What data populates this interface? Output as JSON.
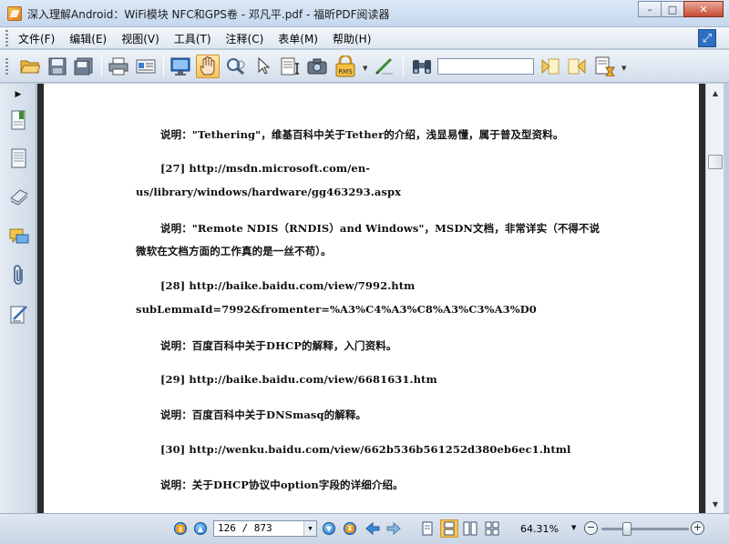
{
  "window": {
    "title": "深入理解Android：WiFi模块 NFC和GPS卷 - 邓凡平.pdf - 福昕PDF阅读器",
    "minimize": "–",
    "maximize": "□",
    "close": "✕"
  },
  "menu": [
    {
      "label": "文件(F)"
    },
    {
      "label": "编辑(E)"
    },
    {
      "label": "视图(V)"
    },
    {
      "label": "工具(T)"
    },
    {
      "label": "注释(C)"
    },
    {
      "label": "表单(M)"
    },
    {
      "label": "帮助(H)"
    }
  ],
  "toolbar": {
    "find_placeholder": "",
    "rms_label": "RMS",
    "active_tool": "hand-tool"
  },
  "document": {
    "lines": [
      "说明：\"Tethering\"，维基百科中关于Tether的介绍，浅显易懂，属于普及型资料。",
      "[27]   http://msdn.microsoft.com/en-",
      "us/library/windows/hardware/gg463293.aspx",
      "说明：\"Remote NDIS（RNDIS）and Windows\"，MSDN文档，非常详实（不得不说",
      "微软在文档方面的工作真的是一丝不苟）。",
      "[28]   http://baike.baidu.com/view/7992.htm",
      "subLemmaId=7992&fromenter=%A3%C4%A3%C8%A3%C3%A3%D0",
      "说明：百度百科中关于DHCP的解释，入门资料。",
      "[29]   http://baike.baidu.com/view/6681631.htm",
      "说明：百度百科中关于DNSmasq的解释。",
      "[30]   http://wenku.baidu.com/view/662b536b561252d380eb6ec1.html",
      "说明：关于DHCP协议中option字段的详细介绍。"
    ]
  },
  "status": {
    "page_display": "126 / 873",
    "zoom": "64.31%",
    "zoom_minus": "−",
    "zoom_plus": "+"
  },
  "colors": {
    "accent": "#2f6fc1",
    "doc_background": "#2b2b2b",
    "active_tool": "#f5c35a"
  }
}
